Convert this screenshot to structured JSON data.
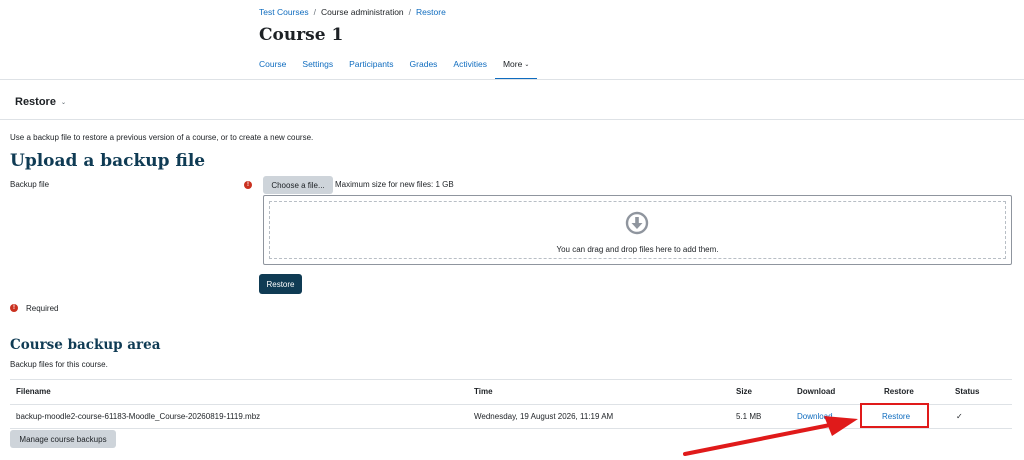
{
  "breadcrumb": {
    "items": [
      "Test Courses",
      "Course administration",
      "Restore"
    ],
    "separator": "/"
  },
  "course_title": "Course 1",
  "nav": {
    "tabs": [
      "Course",
      "Settings",
      "Participants",
      "Grades",
      "Activities",
      "More"
    ],
    "active": "More",
    "caret": "⌄"
  },
  "tertiary": {
    "label": "Restore",
    "caret": "⌄"
  },
  "upload": {
    "intro": "Use a backup file to restore a previous version of a course, or to create a new course.",
    "heading": "Upload a backup file",
    "field_label": "Backup file",
    "required_icon": "!",
    "choose_label": "Choose a file...",
    "max_size": "Maximum size for new files: 1 GB",
    "drop_text": "You can drag and drop files here to add them.",
    "restore_label": "Restore",
    "required_text": "Required"
  },
  "backup_area": {
    "heading": "Course backup area",
    "subtitle": "Backup files for this course.",
    "columns": [
      "Filename",
      "Time",
      "Size",
      "Download",
      "Restore",
      "Status"
    ],
    "rows": [
      {
        "filename": "backup-moodle2-course-61183-Moodle_Course-20260819-1119.mbz",
        "time": "Wednesday, 19 August 2026, 11:19 AM",
        "size": "5.1 MB",
        "download": "Download",
        "restore": "Restore",
        "status": "✓"
      }
    ],
    "manage_label": "Manage course backups"
  },
  "colors": {
    "link": "#0f6cbf",
    "primary_button": "#0f3b54",
    "highlight": "#e01a1a",
    "required": "#ca3120"
  },
  "icons": {
    "drop_icon": "download-arrow-icon",
    "pointer": "red-arrow-annotation"
  }
}
